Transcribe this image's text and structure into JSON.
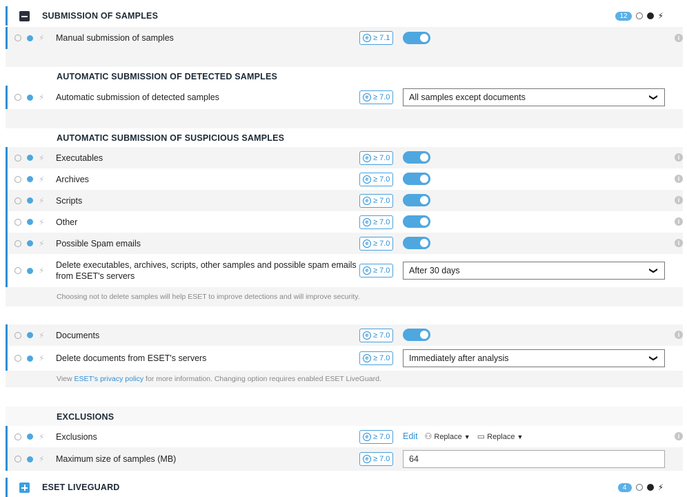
{
  "sections": {
    "submission": {
      "title": "SUBMISSION OF SAMPLES",
      "count": "12"
    },
    "liveguard": {
      "title": "ESET LIVEGUARD",
      "count": "4"
    }
  },
  "headings": {
    "auto_detected": "AUTOMATIC SUBMISSION OF DETECTED SAMPLES",
    "auto_suspicious": "AUTOMATIC SUBMISSION OF SUSPICIOUS SAMPLES",
    "exclusions": "EXCLUSIONS"
  },
  "rows": {
    "manual": {
      "label": "Manual submission of samples",
      "version": "≥ 7.1",
      "enabled": true
    },
    "auto_detected": {
      "label": "Automatic submission of detected samples",
      "version": "≥ 7.0",
      "value": "All samples except documents"
    },
    "executables": {
      "label": "Executables",
      "version": "≥ 7.0",
      "enabled": true
    },
    "archives": {
      "label": "Archives",
      "version": "≥ 7.0",
      "enabled": true
    },
    "scripts": {
      "label": "Scripts",
      "version": "≥ 7.0",
      "enabled": true
    },
    "other": {
      "label": "Other",
      "version": "≥ 7.0",
      "enabled": true
    },
    "spam": {
      "label": "Possible Spam emails",
      "version": "≥ 7.0",
      "enabled": true
    },
    "delete_exec": {
      "label": "Delete executables, archives, scripts, other samples and possible spam emails from ESET's servers",
      "version": "≥ 7.0",
      "value": "After 30 days"
    },
    "documents": {
      "label": "Documents",
      "version": "≥ 7.0",
      "enabled": true
    },
    "delete_docs": {
      "label": "Delete documents from ESET's servers",
      "version": "≥ 7.0",
      "value": "Immediately after analysis"
    },
    "exclusions": {
      "label": "Exclusions",
      "version": "≥ 7.0",
      "edit": "Edit",
      "replace1": "Replace",
      "replace2": "Replace"
    },
    "max_size": {
      "label": "Maximum size of samples (MB)",
      "version": "≥ 7.0",
      "value": "64"
    }
  },
  "notes": {
    "delete_note": "Choosing not to delete samples will help ESET to improve detections and will improve security.",
    "privacy_prefix": "View ",
    "privacy_link": "ESET's privacy policy",
    "privacy_suffix": " for more information. Changing option requires enabled ESET LiveGuard."
  },
  "version_icon": "e",
  "info_icon": "i",
  "accent_color": "#2d8fd5"
}
